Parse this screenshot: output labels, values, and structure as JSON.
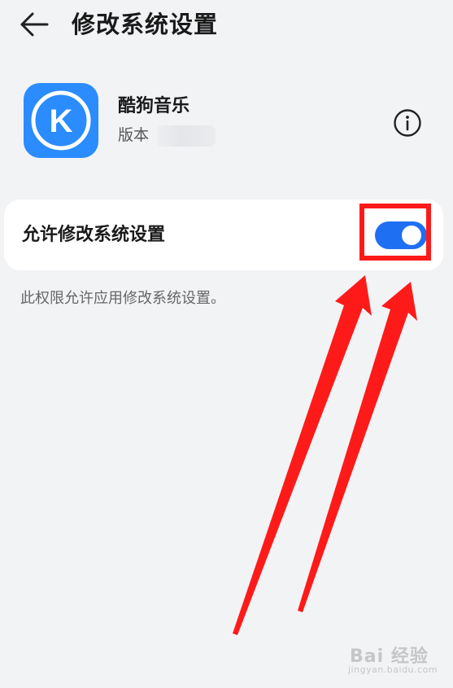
{
  "header": {
    "title": "修改系统设置"
  },
  "app": {
    "name": "酷狗音乐",
    "version_label": "版本",
    "icon_letter": "K"
  },
  "setting": {
    "label": "允许修改系统设置",
    "enabled": true,
    "description": "此权限允许应用修改系统设置。"
  },
  "watermark": {
    "text": "Bai 经验",
    "sub": "jingyan.baidu.com"
  },
  "colors": {
    "background": "#f1f3f5",
    "accent": "#1f6ff2",
    "app_icon": "#2a8cff",
    "annotation": "#ff1a1a"
  },
  "icons": {
    "back": "arrow-left-icon",
    "info": "info-circle-icon"
  }
}
